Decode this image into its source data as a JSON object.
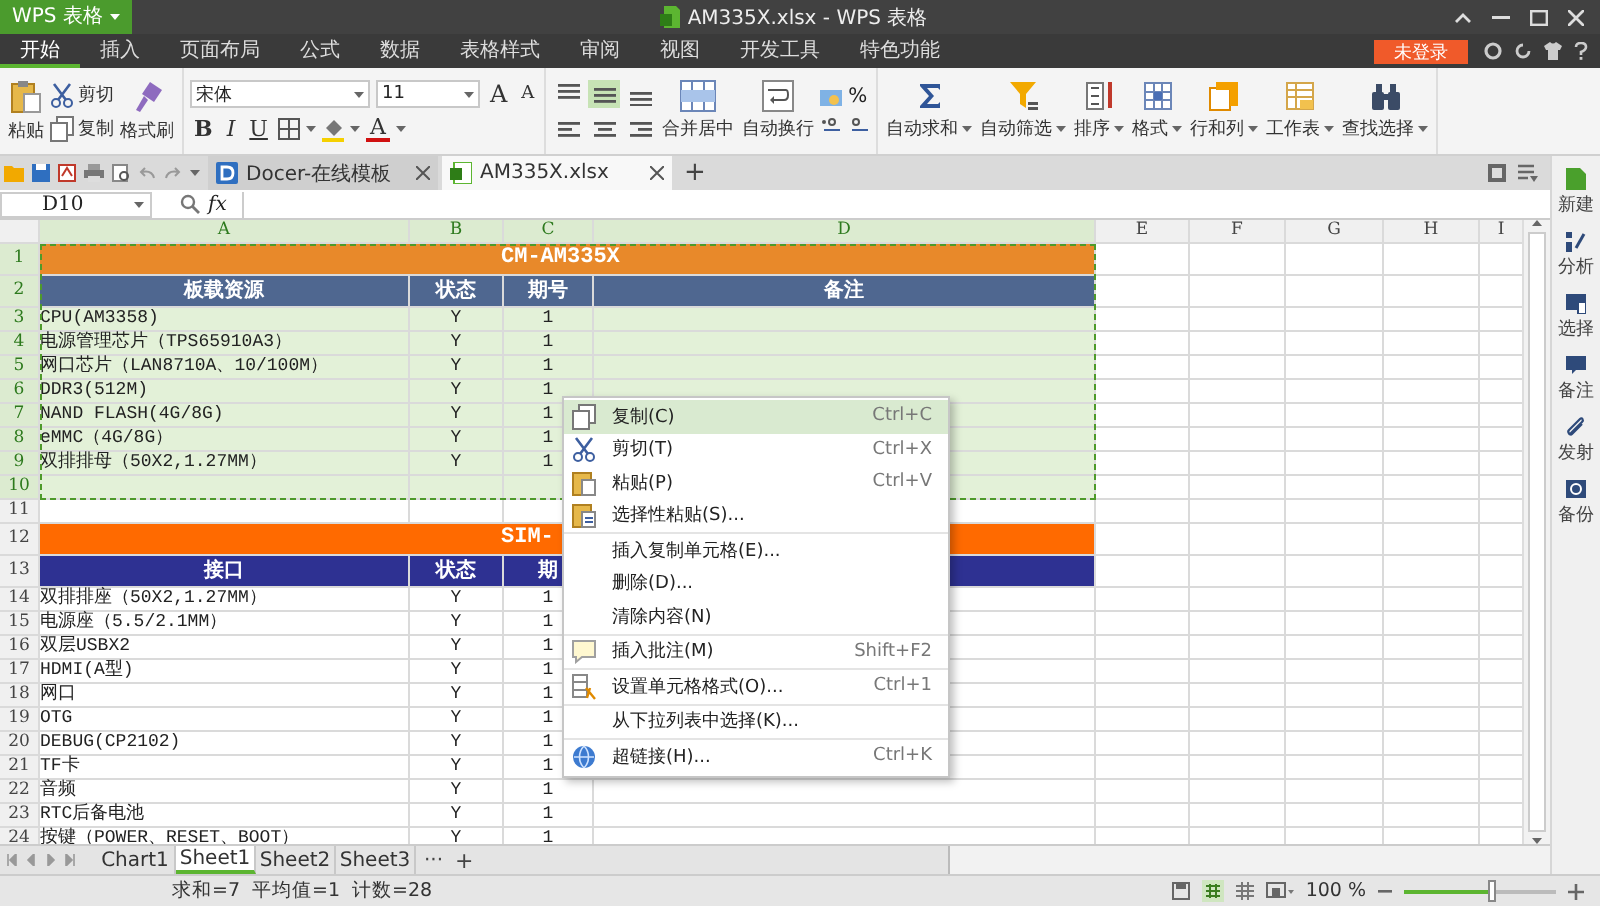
{
  "app": {
    "menu_label": "WPS 表格",
    "title": "AM335X.xlsx - WPS 表格"
  },
  "menu_tabs": [
    {
      "label": "开始",
      "selected": true
    },
    {
      "label": "插入",
      "selected": false
    },
    {
      "label": "页面布局",
      "selected": false
    },
    {
      "label": "公式",
      "selected": false
    },
    {
      "label": "数据",
      "selected": false
    },
    {
      "label": "表格样式",
      "selected": false
    },
    {
      "label": "审阅",
      "selected": false
    },
    {
      "label": "视图",
      "selected": false
    },
    {
      "label": "开发工具",
      "selected": false
    },
    {
      "label": "特色功能",
      "selected": false
    }
  ],
  "login_button": "未登录",
  "ribbon": {
    "clipboard": {
      "paste": "粘贴",
      "cut": "剪切",
      "copy": "复制",
      "format_painter": "格式刷"
    },
    "font": {
      "name": "宋体",
      "size": "11",
      "bold": "B",
      "italic": "I",
      "underline": "U",
      "grow": "A",
      "shrink": "A",
      "color_label": "A"
    },
    "alignment_buttons": [
      {
        "kind": "top",
        "selected": false
      },
      {
        "kind": "middle",
        "selected": true
      },
      {
        "kind": "bottom",
        "selected": false
      },
      {
        "kind": "left",
        "selected": false
      },
      {
        "kind": "center",
        "selected": false
      },
      {
        "kind": "right",
        "selected": false
      }
    ],
    "merge": "合并居中",
    "wrap": "自动换行",
    "percent": "%",
    "tools": [
      {
        "label": "自动求和",
        "kind": "sum"
      },
      {
        "label": "自动筛选",
        "kind": "filter"
      },
      {
        "label": "排序",
        "kind": "sort"
      },
      {
        "label": "格式",
        "kind": "format"
      },
      {
        "label": "行和列",
        "kind": "rowcol"
      },
      {
        "label": "工作表",
        "kind": "sheet"
      },
      {
        "label": "查找选择",
        "kind": "find"
      }
    ]
  },
  "doc_tabs": [
    {
      "label": "Docer-在线模板",
      "kind": "docer",
      "selected": false
    },
    {
      "label": "AM335X.xlsx",
      "kind": "sheet",
      "selected": true
    }
  ],
  "new_tab": "+",
  "name_box": "D10",
  "fx": "fx",
  "columns": [
    {
      "label": "A",
      "selected": true
    },
    {
      "label": "B",
      "selected": true
    },
    {
      "label": "C",
      "selected": true
    },
    {
      "label": "D",
      "selected": true
    },
    {
      "label": "E",
      "selected": false
    },
    {
      "label": "F",
      "selected": false
    },
    {
      "label": "G",
      "selected": false
    },
    {
      "label": "H",
      "selected": false
    },
    {
      "label": "I",
      "selected": false
    }
  ],
  "rows": [
    {
      "number": "1",
      "kind": "title",
      "title": "CM-AM335X",
      "color": "#e8892a",
      "selected": true
    },
    {
      "number": "2",
      "kind": "header",
      "cells": [
        "板载资源",
        "状态",
        "期号",
        "备注"
      ],
      "color": "#4f6790",
      "selected": true
    },
    {
      "number": "3",
      "kind": "data",
      "cells": [
        "CPU(AM3358)",
        "Y",
        "1"
      ],
      "selected": true
    },
    {
      "number": "4",
      "kind": "data",
      "cells": [
        "电源管理芯片（TPS65910A3）",
        "Y",
        "1"
      ],
      "selected": true
    },
    {
      "number": "5",
      "kind": "data",
      "cells": [
        "网口芯片（LAN8710A、10/100M）",
        "Y",
        "1"
      ],
      "selected": true
    },
    {
      "number": "6",
      "kind": "data",
      "cells": [
        "DDR3(512M)",
        "Y",
        "1"
      ],
      "selected": true
    },
    {
      "number": "7",
      "kind": "data",
      "cells": [
        "NAND FLASH(4G/8G)",
        "Y",
        "1"
      ],
      "selected": true
    },
    {
      "number": "8",
      "kind": "data",
      "cells": [
        "eMMC（4G/8G）",
        "Y",
        "1"
      ],
      "selected": true
    },
    {
      "number": "9",
      "kind": "data",
      "cells": [
        "双排排母（50X2,1.27MM）",
        "Y",
        "1"
      ],
      "selected": true
    },
    {
      "number": "10",
      "kind": "empty",
      "selected": true
    },
    {
      "number": "11",
      "kind": "empty",
      "selected": false
    },
    {
      "number": "12",
      "kind": "title",
      "title": "SIM-",
      "color": "#ff6a00",
      "selected": false
    },
    {
      "number": "13",
      "kind": "header",
      "cells": [
        "接口",
        "状态",
        "期"
      ],
      "color": "#2e3192",
      "selected": false
    },
    {
      "number": "14",
      "kind": "data",
      "cells": [
        "双排排座（50X2,1.27MM）",
        "Y",
        "1"
      ],
      "selected": false
    },
    {
      "number": "15",
      "kind": "data",
      "cells": [
        "电源座（5.5/2.1MM）",
        "Y",
        "1"
      ],
      "selected": false
    },
    {
      "number": "16",
      "kind": "data",
      "cells": [
        "双层USBX2",
        "Y",
        "1"
      ],
      "selected": false
    },
    {
      "number": "17",
      "kind": "data",
      "cells": [
        "HDMI(A型)",
        "Y",
        "1"
      ],
      "selected": false
    },
    {
      "number": "18",
      "kind": "data",
      "cells": [
        "网口",
        "Y",
        "1"
      ],
      "selected": false
    },
    {
      "number": "19",
      "kind": "data",
      "cells": [
        "OTG",
        "Y",
        "1"
      ],
      "selected": false
    },
    {
      "number": "20",
      "kind": "data",
      "cells": [
        "DEBUG(CP2102)",
        "Y",
        "1"
      ],
      "selected": false
    },
    {
      "number": "21",
      "kind": "data",
      "cells": [
        "TF卡",
        "Y",
        "1"
      ],
      "selected": false
    },
    {
      "number": "22",
      "kind": "data",
      "cells": [
        "音频",
        "Y",
        "1"
      ],
      "selected": false
    },
    {
      "number": "23",
      "kind": "data",
      "cells": [
        "RTC后备电池",
        "Y",
        "1"
      ],
      "selected": false
    },
    {
      "number": "24",
      "kind": "data",
      "cells": [
        "按键（POWER、RESET、BOOT）",
        "Y",
        "1"
      ],
      "selected": false
    }
  ],
  "context_menu": [
    [
      {
        "kind": "copy",
        "label": "复制(C)",
        "shortcut": "Ctrl+C",
        "selected": true
      },
      {
        "kind": "cut",
        "label": "剪切(T)",
        "shortcut": "Ctrl+X",
        "selected": false
      },
      {
        "kind": "paste",
        "label": "粘贴(P)",
        "shortcut": "Ctrl+V",
        "selected": false
      },
      {
        "kind": "paste-special",
        "label": "选择性粘贴(S)...",
        "selected": false
      }
    ],
    [
      {
        "kind": "none",
        "label": "插入复制单元格(E)...",
        "selected": false
      },
      {
        "kind": "none",
        "label": "删除(D)...",
        "selected": false
      },
      {
        "kind": "none",
        "label": "清除内容(N)",
        "selected": false
      }
    ],
    [
      {
        "kind": "comment",
        "label": "插入批注(M)",
        "shortcut": "Shift+F2",
        "selected": false
      }
    ],
    [
      {
        "kind": "format",
        "label": "设置单元格格式(O)...",
        "shortcut": "Ctrl+1",
        "selected": false
      }
    ],
    [
      {
        "kind": "none",
        "label": "从下拉列表中选择(K)...",
        "selected": false
      }
    ],
    [
      {
        "kind": "link",
        "label": "超链接(H)...",
        "shortcut": "Ctrl+K",
        "selected": false
      }
    ]
  ],
  "sidebar": [
    {
      "label": "新建",
      "kind": "new"
    },
    {
      "label": "分析",
      "kind": "analyze"
    },
    {
      "label": "选择",
      "kind": "select"
    },
    {
      "label": "备注",
      "kind": "note"
    },
    {
      "label": "发射",
      "kind": "send"
    },
    {
      "label": "备份",
      "kind": "backup"
    }
  ],
  "sheet_tabs": [
    {
      "label": "Chart1",
      "selected": false
    },
    {
      "label": "Sheet1",
      "selected": true
    },
    {
      "label": "Sheet2",
      "selected": false
    },
    {
      "label": "Sheet3",
      "selected": false
    }
  ],
  "sheet_more": "···",
  "sheet_add": "+",
  "status": [
    "求和=7",
    "平均值=1",
    "计数=28"
  ],
  "zoom": {
    "reading": "100 %",
    "level": 0.55
  }
}
